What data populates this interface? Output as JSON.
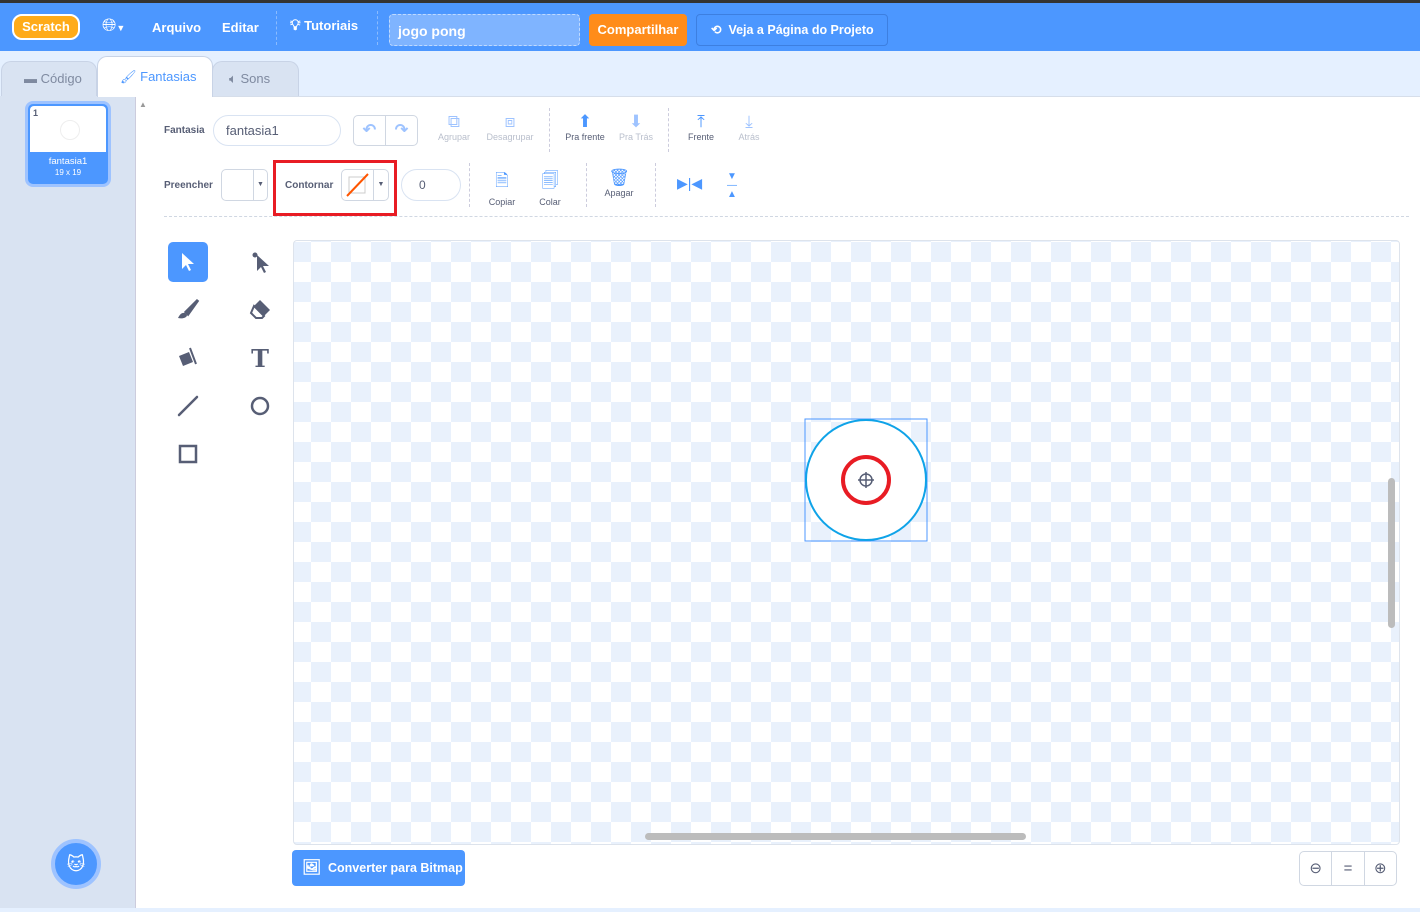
{
  "menubar": {
    "logo": "Scratch",
    "language_icon": "globe-icon",
    "file": "Arquivo",
    "edit": "Editar",
    "tutorials": "Tutoriais",
    "project_title": "jogo pong",
    "share": "Compartilhar",
    "view_page": "Veja a Página do Projeto"
  },
  "tabs": [
    {
      "label": "Código",
      "icon": "code-icon"
    },
    {
      "label": "Fantasias",
      "icon": "brush-icon",
      "active": true
    },
    {
      "label": "Sons",
      "icon": "speaker-icon"
    }
  ],
  "costumes": [
    {
      "index": "1",
      "name": "fantasia1",
      "size": "19 x 19",
      "selected": true
    }
  ],
  "toolbar": {
    "costume_label": "Fantasia",
    "costume_name": "fantasia1",
    "group": "Agrupar",
    "ungroup": "Desagrupar",
    "forward": "Pra frente",
    "backward": "Pra Trás",
    "front": "Frente",
    "back": "Atrás",
    "fill_label": "Preencher",
    "fill_color": "#ffffff",
    "outline_label": "Contornar",
    "outline_color": "none",
    "outline_width": "0",
    "copy": "Copiar",
    "paste": "Colar",
    "delete": "Apagar"
  },
  "tools": [
    "select",
    "reshape",
    "brush",
    "eraser",
    "fill",
    "text",
    "line",
    "circle",
    "rectangle"
  ],
  "canvas": {
    "shape": "circle",
    "stroke_color": "#0fa3e8"
  },
  "convert_button": "Converter para Bitmap",
  "colors": {
    "primary": "#4c97ff",
    "share": "#ff8c1a",
    "annotation": "#e81c24"
  }
}
